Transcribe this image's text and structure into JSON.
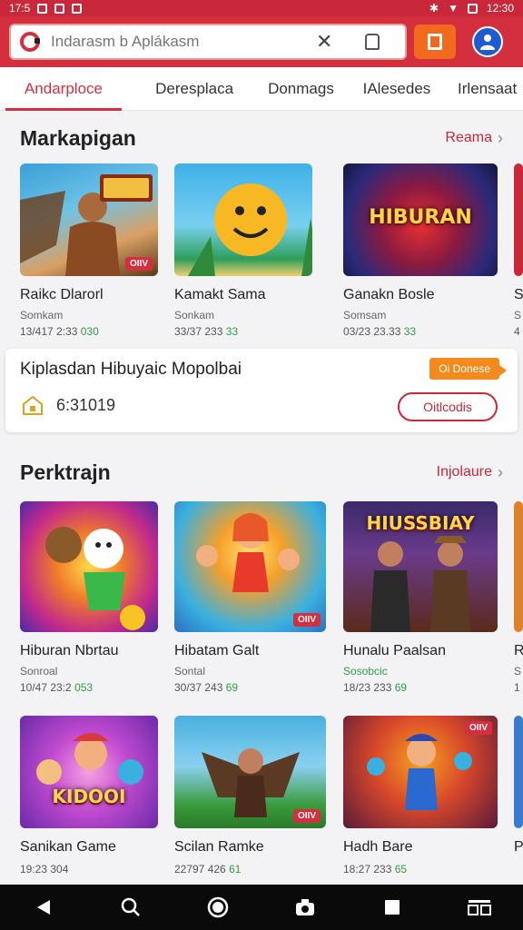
{
  "status_bar": {
    "time_left": "17:5",
    "time_right": "12:30"
  },
  "search": {
    "placeholder": "Indarasm b Aplákasm"
  },
  "tabs": [
    {
      "label": "Andarploce",
      "active": true
    },
    {
      "label": "Deresplaca",
      "active": false
    },
    {
      "label": "Donmags",
      "active": false
    },
    {
      "label": "IAlesedes",
      "active": false
    },
    {
      "label": "Irlensaat",
      "active": false
    }
  ],
  "section1": {
    "title": "Markapigan",
    "link": "Reama",
    "cards": [
      {
        "title": "Raikc Dlarorl",
        "sub": "Somkam",
        "meta": "13/417 2:33",
        "meta_green": "030",
        "badge": "OIIV",
        "art_text": ""
      },
      {
        "title": "Kamakt Sama",
        "sub": "Sonkam",
        "meta": "33/37 233",
        "meta_green": "33",
        "badge": "",
        "art_text": ""
      },
      {
        "title": "Ganakn Bosle",
        "sub": "Somsam",
        "meta": "03/23 23.33",
        "meta_green": "33",
        "badge": "",
        "art_text": "HIBURAN"
      },
      {
        "title": "S",
        "sub": "S",
        "meta": "4",
        "meta_green": "",
        "badge": "",
        "art_text": ""
      }
    ]
  },
  "promo": {
    "title": "Kiplasdan Hibuyaic Mopolbai",
    "tag": "Oi Donese",
    "count": "6:31019",
    "button": "Oitlcodis"
  },
  "section2": {
    "title": "Perktrajn",
    "link": "Injolaure",
    "cards": [
      {
        "title": "Hiburan Nbrtau",
        "sub": "Sonroal",
        "meta": "10/47 23:2",
        "meta_green": "053",
        "badge": "",
        "art_text": ""
      },
      {
        "title": "Hibatam Galt",
        "sub": "Sontal",
        "meta": "30/37 243",
        "meta_green": "69",
        "badge": "OIIV",
        "art_text": ""
      },
      {
        "title": "Hunalu Paalsan",
        "sub": "Sosobcic",
        "meta": "18/23 233",
        "meta_green": "69",
        "badge": "",
        "art_text": "HIUSSBIAY"
      },
      {
        "title": "R",
        "sub": "S",
        "meta": "1",
        "meta_green": "",
        "badge": "",
        "art_text": ""
      }
    ],
    "cards2": [
      {
        "title": "Sanikan Game",
        "meta": "19:23 304",
        "meta_green": "",
        "badge": "",
        "art_text": "KIDOOI"
      },
      {
        "title": "Scilan Ramke",
        "meta": "22797 426",
        "meta_green": "61",
        "badge": "OIIV",
        "art_text": ""
      },
      {
        "title": "Hadh Bare",
        "meta": "18:27 233",
        "meta_green": "65",
        "badge": "OIIV",
        "art_text": ""
      },
      {
        "title": "P",
        "meta": "",
        "meta_green": "",
        "badge": "",
        "art_text": ""
      }
    ]
  },
  "colors": {
    "brand": "#d32f3f",
    "accent": "#f26a1d",
    "link": "#c8283a"
  },
  "icons": [
    "back-icon",
    "search-icon",
    "home-icon",
    "camera-icon",
    "square-icon",
    "grid-icon"
  ]
}
